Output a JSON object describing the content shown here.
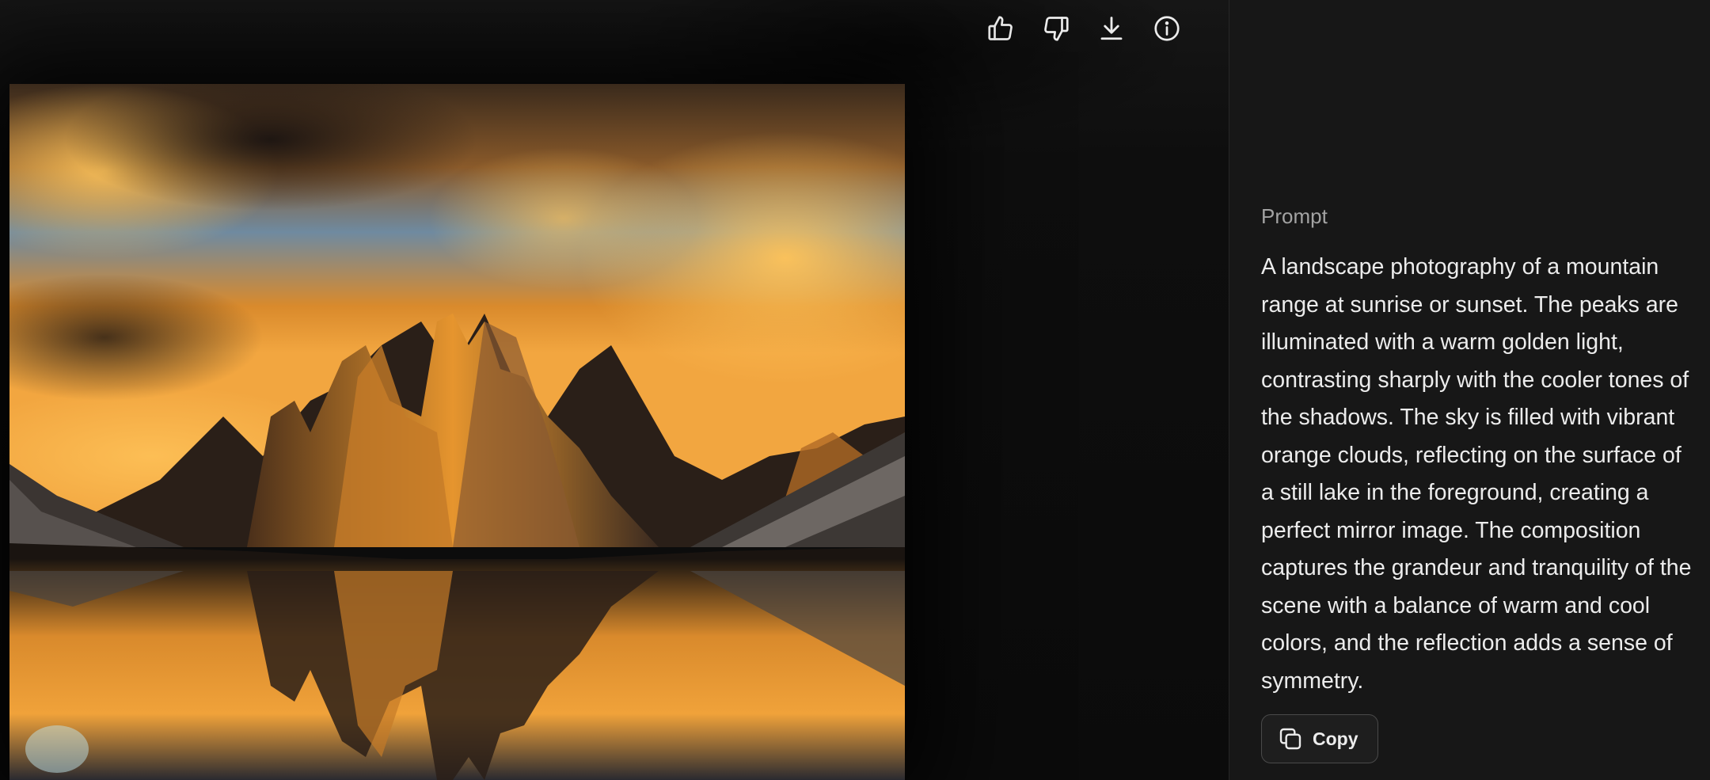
{
  "toolbar": {
    "icons": [
      "thumbs-up-icon",
      "thumbs-down-icon",
      "download-icon",
      "info-icon"
    ]
  },
  "image": {
    "subject": "mountain-reflection-sunset"
  },
  "panel": {
    "prompt_label": "Prompt",
    "prompt_text": "A landscape photography of a mountain range at sunrise or sunset. The peaks are illuminated with a warm golden light, contrasting sharply with the cooler tones of the shadows. The sky is filled with vibrant orange clouds, reflecting on the surface of a still lake in the foreground, creating a perfect mirror image. The composition captures the grandeur and tranquility of the scene with a balance of warm and cool colors, and the reflection adds a sense of symmetry.",
    "copy_label": "Copy"
  },
  "colors": {
    "panel_bg": "#171717",
    "viewer_bg": "#0a0a0a",
    "text": "#ececec",
    "muted": "#a3a3a3"
  }
}
